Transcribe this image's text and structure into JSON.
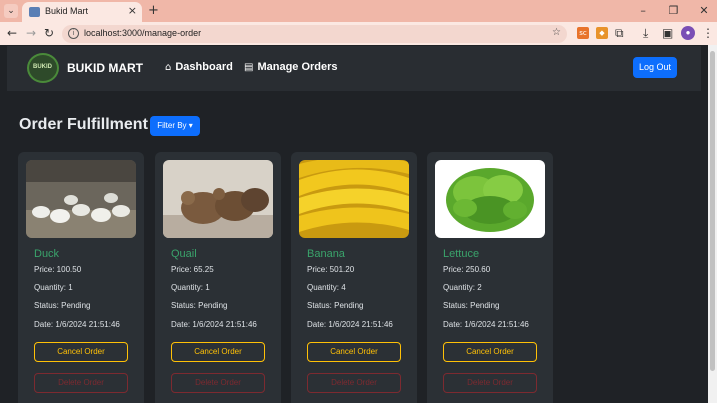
{
  "browser": {
    "tab_title": "Bukid Mart",
    "url": "localhost:3000/manage-order"
  },
  "navbar": {
    "logo_text": "BUKID",
    "brand": "BUKID MART",
    "links": [
      {
        "label": "Dashboard",
        "icon": "home-icon"
      },
      {
        "label": "Manage Orders",
        "icon": "list-icon"
      }
    ],
    "logout_label": "Log Out"
  },
  "page": {
    "title": "Order Fulfillment",
    "filter_label": "Filter By"
  },
  "colors": {
    "accent": "#0d6efd",
    "product_name": "#3aa36b",
    "cancel": "#ffc107",
    "delete": "#7d2a30"
  },
  "orders": [
    {
      "name": "Duck",
      "price": "Price: 100.50",
      "quantity": "Quantity: 1",
      "status": "Status: Pending",
      "date": "Date: 1/6/2024 21:51:46",
      "cancel_label": "Cancel Order",
      "delete_label": "Delete Order"
    },
    {
      "name": "Quail",
      "price": "Price: 65.25",
      "quantity": "Quantity: 1",
      "status": "Status: Pending",
      "date": "Date: 1/6/2024 21:51:46",
      "cancel_label": "Cancel Order",
      "delete_label": "Delete Order"
    },
    {
      "name": "Banana",
      "price": "Price: 501.20",
      "quantity": "Quantity: 4",
      "status": "Status: Pending",
      "date": "Date: 1/6/2024 21:51:46",
      "cancel_label": "Cancel Order",
      "delete_label": "Delete Order"
    },
    {
      "name": "Lettuce",
      "price": "Price: 250.60",
      "quantity": "Quantity: 2",
      "status": "Status: Pending",
      "date": "Date: 1/6/2024 21:51:46",
      "cancel_label": "Cancel Order",
      "delete_label": "Delete Order"
    }
  ]
}
